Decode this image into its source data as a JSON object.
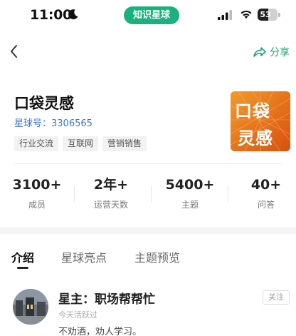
{
  "status_bar": {
    "time": "11:00",
    "app_name": "知识星球",
    "battery": "53",
    "battery_level": 0.53
  },
  "nav": {
    "share_label": "分享"
  },
  "planet": {
    "title": "口袋灵感",
    "id_line": "星球号：3306565",
    "tags": [
      "行业交流",
      "互联网",
      "营销销售"
    ],
    "cover_line1": "口袋",
    "cover_line2": "灵感"
  },
  "stats": [
    {
      "value": "3100+",
      "label": "成员"
    },
    {
      "value": "2年+",
      "label": "运营天数"
    },
    {
      "value": "5400+",
      "label": "主题"
    },
    {
      "value": "40+",
      "label": "问答"
    }
  ],
  "tabs": [
    {
      "label": "介绍",
      "active": true
    },
    {
      "label": "星球亮点",
      "active": false
    },
    {
      "label": "主题预览",
      "active": false
    }
  ],
  "owner": {
    "name": "星主：职场帮帮忙",
    "follow_label": "关注",
    "active_time": "今天活跃过",
    "description": "不劝酒，劝人学习。"
  },
  "colors": {
    "accent": "#1bb17f",
    "link": "#3a77c8",
    "cover": "#e86b16"
  }
}
